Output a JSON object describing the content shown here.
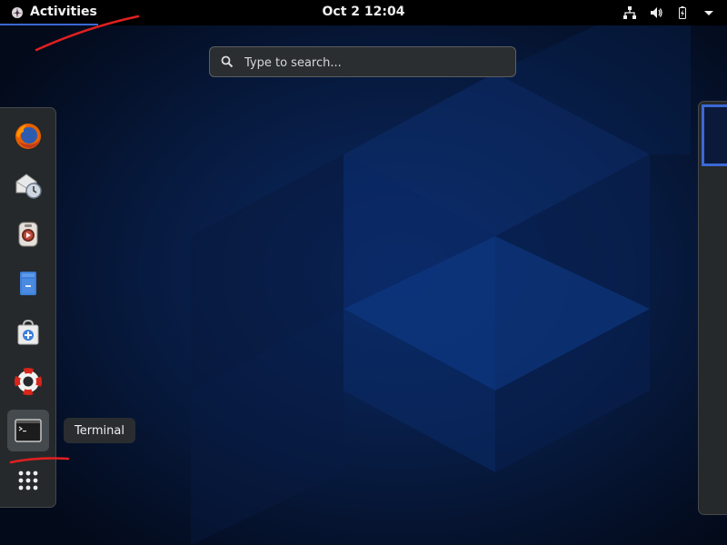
{
  "topbar": {
    "activities_label": "Activities",
    "clock": "Oct 2  12:04",
    "indicators": [
      "network-icon",
      "volume-icon",
      "battery-icon",
      "system-menu-arrow-icon"
    ]
  },
  "search": {
    "placeholder": "Type to search..."
  },
  "dash": {
    "items": [
      {
        "name": "firefox",
        "icon": "firefox-icon"
      },
      {
        "name": "evolution",
        "icon": "evolution-mail-icon"
      },
      {
        "name": "rhythmbox",
        "icon": "rhythmbox-icon"
      },
      {
        "name": "files",
        "icon": "files-icon"
      },
      {
        "name": "software",
        "icon": "software-icon"
      },
      {
        "name": "help",
        "icon": "help-icon"
      },
      {
        "name": "terminal",
        "icon": "terminal-icon",
        "active": true
      },
      {
        "name": "show-applications",
        "icon": "app-grid-icon"
      }
    ],
    "tooltip": "Terminal"
  },
  "colors": {
    "accent": "#3b68d4",
    "background": "#061226",
    "annotation": "#e02020"
  }
}
